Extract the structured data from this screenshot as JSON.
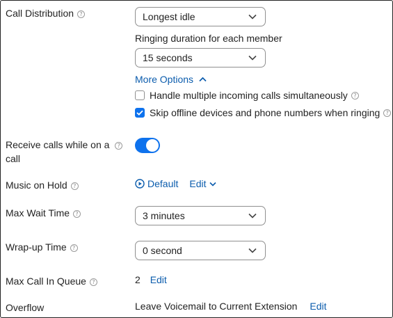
{
  "call_distribution": {
    "label": "Call Distribution",
    "value": "Longest idle",
    "ringing_label": "Ringing duration for each member",
    "ringing_value": "15 seconds",
    "more_options": "More Options",
    "options": [
      {
        "label": "Handle multiple incoming calls simultaneously",
        "checked": false
      },
      {
        "label": "Skip offline devices and phone numbers when ringing",
        "checked": true
      }
    ]
  },
  "receive_calls": {
    "label_line1": "Receive calls while on a",
    "label_line2": "call",
    "enabled": true
  },
  "music_on_hold": {
    "label": "Music on Hold",
    "value": "Default",
    "edit": "Edit"
  },
  "max_wait_time": {
    "label": "Max Wait Time",
    "value": "3 minutes"
  },
  "wrap_up_time": {
    "label": "Wrap-up Time",
    "value": "0 second"
  },
  "max_call_in_queue": {
    "label": "Max Call In Queue",
    "value": "2",
    "edit": "Edit"
  },
  "overflow": {
    "label": "Overflow",
    "value": "Leave Voicemail to Current Extension",
    "edit": "Edit"
  },
  "help_glyph": "?",
  "colors": {
    "accent": "#0e72ed",
    "link": "#0b5cad",
    "text": "#222222",
    "border": "#8f8f8f"
  },
  "icons": {
    "dropdown": "chevron-down-icon",
    "help": "question-circle-icon",
    "play": "play-circle-icon",
    "check": "check-icon"
  }
}
